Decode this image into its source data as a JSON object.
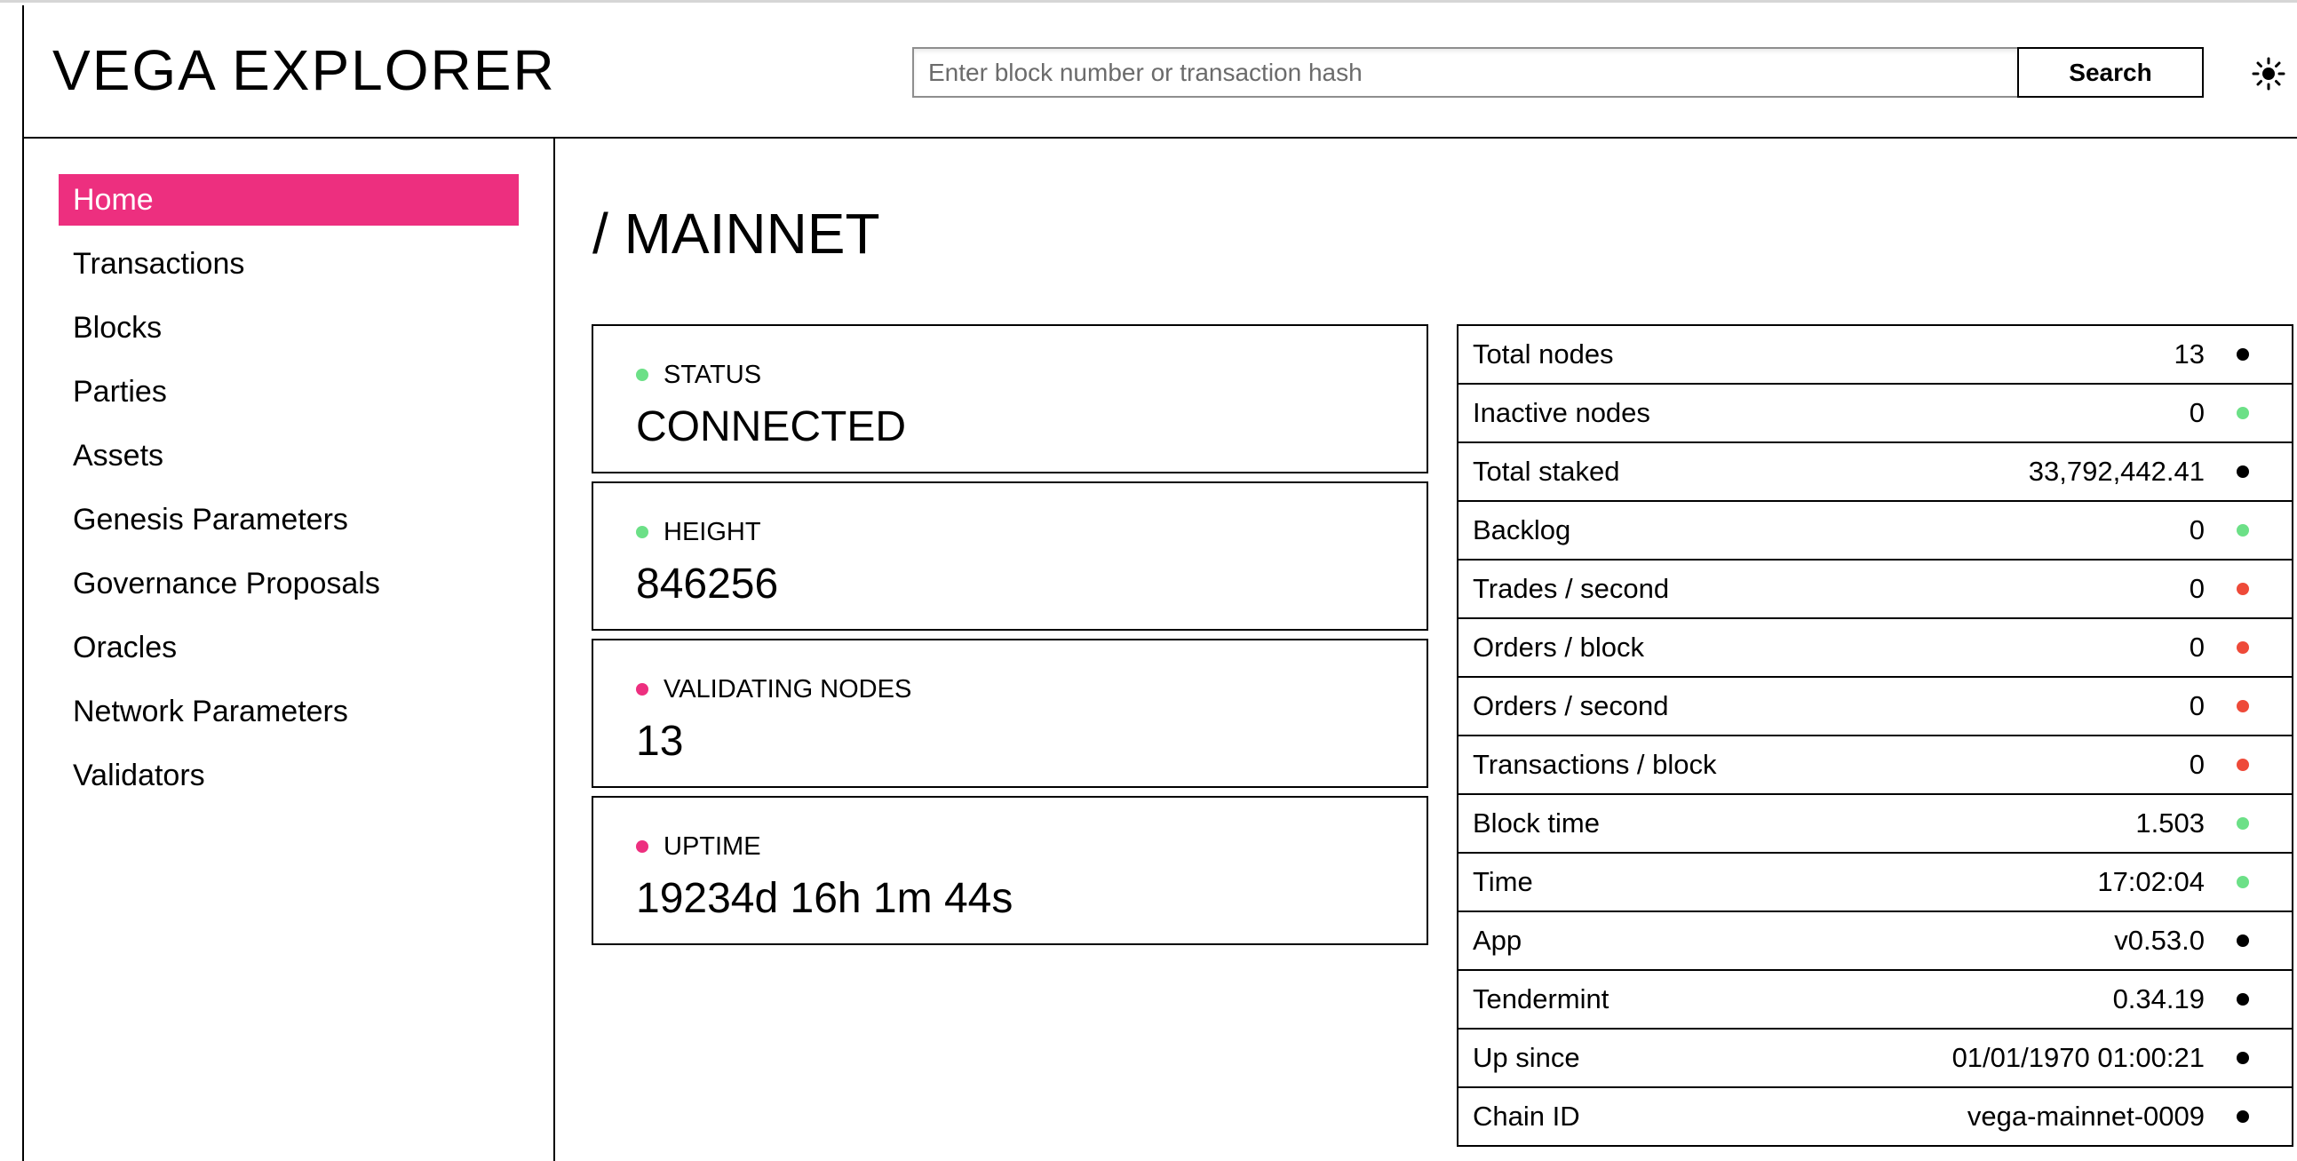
{
  "header": {
    "logo": "VEGA EXPLORER",
    "search_placeholder": "Enter block number or transaction hash",
    "search_value": "",
    "search_button": "Search",
    "theme_icon": "sun-icon"
  },
  "sidebar": {
    "items": [
      {
        "label": "Home",
        "active": true
      },
      {
        "label": "Transactions",
        "active": false
      },
      {
        "label": "Blocks",
        "active": false
      },
      {
        "label": "Parties",
        "active": false
      },
      {
        "label": "Assets",
        "active": false
      },
      {
        "label": "Genesis Parameters",
        "active": false
      },
      {
        "label": "Governance Proposals",
        "active": false
      },
      {
        "label": "Oracles",
        "active": false
      },
      {
        "label": "Network Parameters",
        "active": false
      },
      {
        "label": "Validators",
        "active": false
      }
    ]
  },
  "main": {
    "title": "/ MAINNET",
    "stats": [
      {
        "label": "STATUS",
        "value": "CONNECTED",
        "status": "green"
      },
      {
        "label": "HEIGHT",
        "value": "846256",
        "status": "green"
      },
      {
        "label": "VALIDATING NODES",
        "value": "13",
        "status": "pink"
      },
      {
        "label": "UPTIME",
        "value": "19234d 16h 1m 44s",
        "status": "pink"
      }
    ],
    "metrics": [
      {
        "label": "Total nodes",
        "value": "13",
        "status": "black"
      },
      {
        "label": "Inactive nodes",
        "value": "0",
        "status": "green"
      },
      {
        "label": "Total staked",
        "value": "33,792,442.41",
        "status": "black"
      },
      {
        "label": "Backlog",
        "value": "0",
        "status": "green"
      },
      {
        "label": "Trades / second",
        "value": "0",
        "status": "red"
      },
      {
        "label": "Orders / block",
        "value": "0",
        "status": "red"
      },
      {
        "label": "Orders / second",
        "value": "0",
        "status": "red"
      },
      {
        "label": "Transactions / block",
        "value": "0",
        "status": "red"
      },
      {
        "label": "Block time",
        "value": "1.503",
        "status": "green"
      },
      {
        "label": "Time",
        "value": "17:02:04",
        "status": "green"
      },
      {
        "label": "App",
        "value": "v0.53.0",
        "status": "black"
      },
      {
        "label": "Tendermint",
        "value": "0.34.19",
        "status": "black"
      },
      {
        "label": "Up since",
        "value": "01/01/1970 01:00:21",
        "status": "black"
      },
      {
        "label": "Chain ID",
        "value": "vega-mainnet-0009",
        "status": "black"
      }
    ]
  },
  "colors": {
    "accent": "#ed2f7f",
    "green": "#6ce087",
    "red": "#ee4a39",
    "black": "#000000"
  }
}
